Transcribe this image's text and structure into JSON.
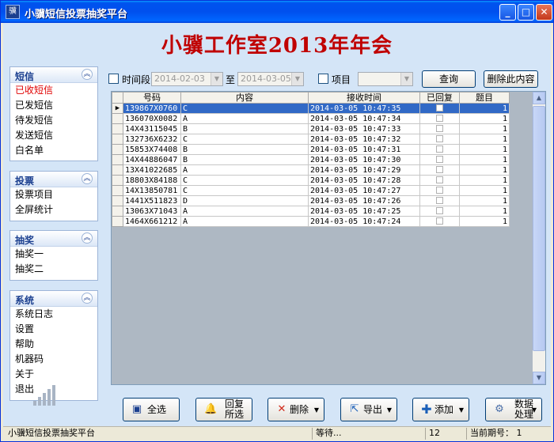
{
  "window": {
    "title": "小骥短信投票抽奖平台",
    "icon": "app-icon",
    "icon_text": "骥"
  },
  "banner": "小骥工作室2013年年会",
  "sidebar": {
    "groups": [
      {
        "title": "短信",
        "items": [
          "已收短信",
          "已发短信",
          "待发短信",
          "发送短信",
          "白名单"
        ]
      },
      {
        "title": "投票",
        "items": [
          "投票项目",
          "全屏统计"
        ]
      },
      {
        "title": "抽奖",
        "items": [
          "抽奖一",
          "抽奖二"
        ]
      },
      {
        "title": "系统",
        "items": [
          "系统日志",
          "设置",
          "帮助",
          "机器码",
          "关于",
          "退出"
        ]
      }
    ],
    "active_item": "已收短信"
  },
  "filter": {
    "time_label": "时间段",
    "date_from": "2014-02-03",
    "to_label": "至",
    "date_to": "2014-03-05",
    "project_label": "项目",
    "project_value": "",
    "query_button": "查询",
    "delete_button": "删除此内容"
  },
  "table": {
    "columns": [
      "号码",
      "内容",
      "接收时间",
      "已回复",
      "题目"
    ],
    "rows": [
      {
        "number": "139867X0760",
        "content": "C",
        "time": "2014-03-05  10:47:35",
        "replied": false,
        "topic": "1",
        "selected": true
      },
      {
        "number": "136070X0082",
        "content": "A",
        "time": "2014-03-05  10:47:34",
        "replied": false,
        "topic": "1"
      },
      {
        "number": "14X43115045",
        "content": "B",
        "time": "2014-03-05  10:47:33",
        "replied": false,
        "topic": "1"
      },
      {
        "number": "132736X6232",
        "content": "C",
        "time": "2014-03-05  10:47:32",
        "replied": false,
        "topic": "1"
      },
      {
        "number": "15853X74408",
        "content": "B",
        "time": "2014-03-05  10:47:31",
        "replied": false,
        "topic": "1"
      },
      {
        "number": "14X44886047",
        "content": "B",
        "time": "2014-03-05  10:47:30",
        "replied": false,
        "topic": "1"
      },
      {
        "number": "13X41022685",
        "content": "A",
        "time": "2014-03-05  10:47:29",
        "replied": false,
        "topic": "1"
      },
      {
        "number": "18803X84188",
        "content": "C",
        "time": "2014-03-05  10:47:28",
        "replied": false,
        "topic": "1"
      },
      {
        "number": "14X13850781",
        "content": "C",
        "time": "2014-03-05  10:47:27",
        "replied": false,
        "topic": "1"
      },
      {
        "number": "1441X511823",
        "content": "D",
        "time": "2014-03-05  10:47:26",
        "replied": false,
        "topic": "1"
      },
      {
        "number": "13063X71043",
        "content": "A",
        "time": "2014-03-05  10:47:25",
        "replied": false,
        "topic": "1"
      },
      {
        "number": "1464X661212",
        "content": "A",
        "time": "2014-03-05  10:47:24",
        "replied": false,
        "topic": "1"
      }
    ]
  },
  "actions": {
    "select_all": "全选",
    "reply_selected_1": "回复",
    "reply_selected_2": "所选",
    "delete": "删除",
    "export": "导出",
    "add": "添加",
    "process_1": "数据",
    "process_2": "处理"
  },
  "status": {
    "app_name": "小骥短信投票抽奖平台",
    "waiting": "等待...",
    "count": "12",
    "period_label": "当前期号：",
    "period_value": "1"
  },
  "colors": {
    "banner": "#c00000",
    "selection": "#3169c6",
    "active_item": "#e00000"
  }
}
